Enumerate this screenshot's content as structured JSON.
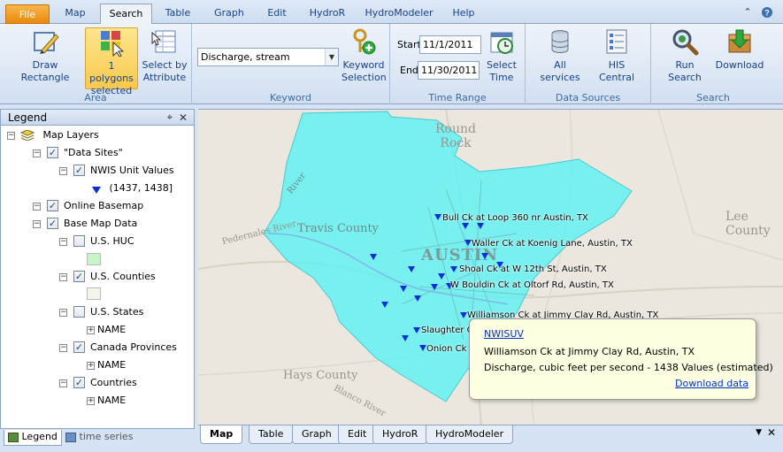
{
  "ribbon_tabs": [
    {
      "label": "File"
    },
    {
      "label": "Map"
    },
    {
      "label": "Search"
    },
    {
      "label": "Table"
    },
    {
      "label": "Graph"
    },
    {
      "label": "Edit"
    },
    {
      "label": "HydroR"
    },
    {
      "label": "HydroModeler"
    },
    {
      "label": "Help"
    }
  ],
  "ribbon": {
    "area": {
      "label": "Area",
      "draw_rectangle": "Draw Rectangle",
      "polygons_selected": [
        "1 polygons",
        "selected"
      ],
      "select_by_attribute": [
        "Select by",
        "Attribute"
      ]
    },
    "keyword": {
      "label": "Keyword",
      "value": "Discharge, stream",
      "selection": [
        "Keyword",
        "Selection"
      ]
    },
    "time_range": {
      "label": "Time Range",
      "start_label": "Start",
      "start": "11/1/2011",
      "end_label": "End",
      "end": "11/30/2011",
      "select_time": [
        "Select",
        "Time"
      ]
    },
    "data_sources": {
      "label": "Data Sources",
      "all_services": "All services",
      "his_central": "HIS Central"
    },
    "search": {
      "label": "Search",
      "run_search": "Run Search",
      "download": "Download"
    }
  },
  "legend": {
    "title": "Legend",
    "nodes": {
      "map_layers": "Map Layers",
      "data_sites": "\"Data Sites\"",
      "nwis": "NWIS Unit Values",
      "nwis_range": "(1437, 1438]",
      "online_basemap": "Online Basemap",
      "base_map_data": "Base Map Data",
      "us_huc": "U.S. HUC",
      "us_counties": "U.S. Counties",
      "us_states": "U.S. States",
      "states_name": "NAME",
      "canada": "Canada Provinces",
      "canada_name": "NAME",
      "countries": "Countries",
      "countries_name": "NAME"
    },
    "tabs": {
      "legend": "Legend",
      "time_series": "time series"
    }
  },
  "map": {
    "place_labels": {
      "round_rock": [
        "Round",
        "Rock"
      ],
      "travis": "Travis County",
      "austin": "AUSTIN",
      "lee": "Lee County",
      "hays": "Hays County",
      "pedernales": "Pedernales River",
      "river": "River",
      "blanco": "Blanco River"
    },
    "sites": [
      "Bull Ck at Loop 360 nr Austin, TX",
      "Waller Ck at Koenig Lane, Austin, TX",
      "Shoal Ck at W 12th St, Austin, TX",
      "W Bouldin Ck at Oltorf Rd, Austin, TX",
      "Williamson Ck at Jimmy Clay Rd, Austin, TX",
      "Slaughter C",
      "Onion Ck"
    ],
    "popup": {
      "link": "NWISUV",
      "site": "Williamson Ck at Jimmy Clay Rd, Austin, TX",
      "detail": "Discharge, cubic feet per second - 1438 Values (estimated)",
      "download": "Download data"
    }
  },
  "bottom_tabs": [
    {
      "label": "Map"
    },
    {
      "label": "Table"
    },
    {
      "label": "Graph"
    },
    {
      "label": "Edit"
    },
    {
      "label": "HydroR"
    },
    {
      "label": "HydroModeler"
    }
  ],
  "colors": {
    "county_fill": "#5ef2f4",
    "site_marker": "#0a2fd6",
    "file_tab": "#ef9a1c",
    "selected_button": "#f9cf5a"
  }
}
